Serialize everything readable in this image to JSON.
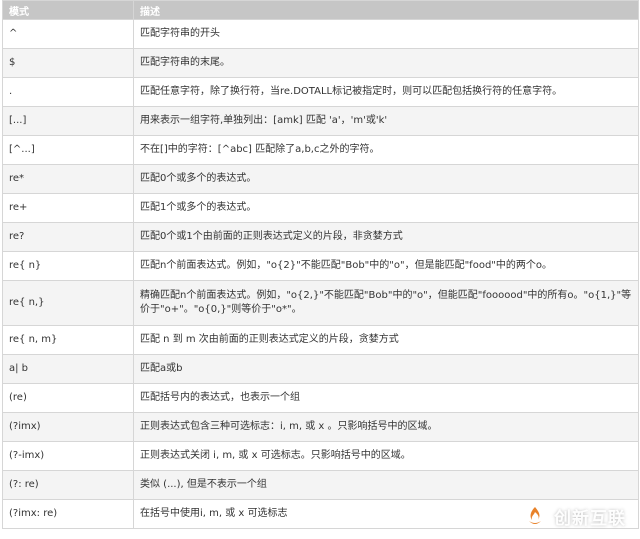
{
  "header": {
    "col1": "模式",
    "col2": "描述"
  },
  "rows": [
    {
      "pattern": "^",
      "desc": "匹配字符串的开头"
    },
    {
      "pattern": "$",
      "desc": "匹配字符串的末尾。"
    },
    {
      "pattern": ".",
      "desc": "匹配任意字符，除了换行符，当re.DOTALL标记被指定时，则可以匹配包括换行符的任意字符。"
    },
    {
      "pattern": "[...]",
      "desc": "用来表示一组字符,单独列出：[amk] 匹配 'a'，'m'或'k'"
    },
    {
      "pattern": "[^...]",
      "desc": "不在[]中的字符：[^abc] 匹配除了a,b,c之外的字符。"
    },
    {
      "pattern": "re*",
      "desc": "匹配0个或多个的表达式。"
    },
    {
      "pattern": "re+",
      "desc": "匹配1个或多个的表达式。"
    },
    {
      "pattern": "re?",
      "desc": "匹配0个或1个由前面的正则表达式定义的片段，非贪婪方式"
    },
    {
      "pattern": "re{ n}",
      "desc": "匹配n个前面表达式。例如，\"o{2}\"不能匹配\"Bob\"中的\"o\"，但是能匹配\"food\"中的两个o。"
    },
    {
      "pattern": "re{ n,}",
      "desc": "精确匹配n个前面表达式。例如，\"o{2,}\"不能匹配\"Bob\"中的\"o\"，但能匹配\"foooood\"中的所有o。\"o{1,}\"等价于\"o+\"。\"o{0,}\"则等价于\"o*\"。"
    },
    {
      "pattern": "re{ n, m}",
      "desc": "匹配 n 到 m 次由前面的正则表达式定义的片段，贪婪方式"
    },
    {
      "pattern": "a| b",
      "desc": "匹配a或b"
    },
    {
      "pattern": "(re)",
      "desc": "匹配括号内的表达式，也表示一个组"
    },
    {
      "pattern": "(?imx)",
      "desc": "正则表达式包含三种可选标志：i, m, 或 x 。只影响括号中的区域。"
    },
    {
      "pattern": "(?-imx)",
      "desc": "正则表达式关闭 i, m, 或 x 可选标志。只影响括号中的区域。"
    },
    {
      "pattern": "(?: re)",
      "desc": "类似 (...), 但是不表示一个组"
    },
    {
      "pattern": "(?imx: re)",
      "desc": "在括号中使用i, m, 或 x 可选标志"
    }
  ],
  "watermark": {
    "text": "创新互联",
    "icon": "flame-logo-icon"
  }
}
